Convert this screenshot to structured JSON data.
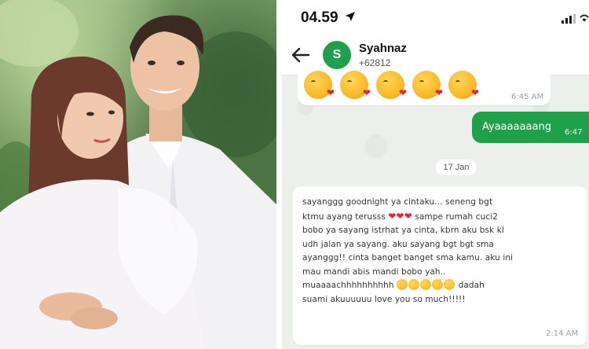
{
  "status_bar": {
    "time": "04.59"
  },
  "header": {
    "avatar_initial": "S",
    "name": "Syahnaz",
    "number": "+62812"
  },
  "messages": {
    "emoji_time": "6:45 AM",
    "outgoing_text": "Ayaaaaaaang",
    "outgoing_time": "6:47",
    "date_separator": "17 Jan",
    "long_lines": [
      "sayanggg goodnight ya cintaku... seneng bgt",
      "ktmu ayang terusss",
      "sampe rumah cuci2",
      "bobo ya sayang istrhat ya cinta, kbrn aku bsk kl",
      "udh jalan ya sayang. aku sayang bgt bgt sma",
      "ayanggg!! cinta banget banget sma kamu. aku ini",
      "mau mandi abis mandi bobo yah..",
      "muaaaachhhhhhhhhh",
      "dadah",
      "suami akuuuuuu love you so much!!!!!"
    ],
    "long_time": "2:14 AM"
  },
  "icons": {
    "location": "location-arrow-icon",
    "signal": "signal-bars-icon",
    "wifi": "wifi-icon",
    "back": "back-arrow-icon",
    "kiss": "face-blowing-kiss-icon",
    "heart": "red-heart-icon"
  },
  "colors": {
    "accent": "#1ea14a",
    "chat_bg": "#ecefec"
  }
}
